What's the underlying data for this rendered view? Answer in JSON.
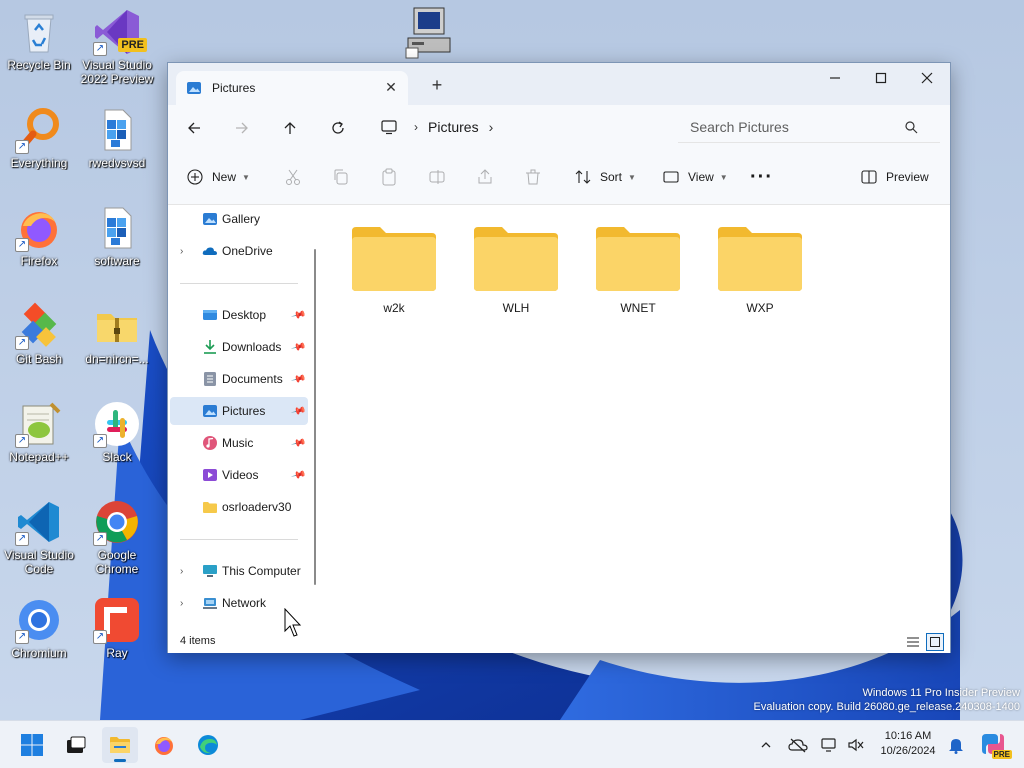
{
  "desktop": {
    "icons": [
      {
        "label": "Recycle Bin",
        "icon": "recycle-bin-icon"
      },
      {
        "label": "Visual Studio 2022 Preview",
        "icon": "visual-studio-icon",
        "badge": "PRE"
      },
      {
        "label": "Everything",
        "icon": "everything-search-icon"
      },
      {
        "label": "rwedvsvsd",
        "icon": "installer-file-icon"
      },
      {
        "label": "Firefox",
        "icon": "firefox-icon"
      },
      {
        "label": "software",
        "icon": "installer-file-icon"
      },
      {
        "label": "Git Bash",
        "icon": "git-bash-icon"
      },
      {
        "label": "dn=nircn=...",
        "icon": "zip-archive-icon"
      },
      {
        "label": "Notepad++",
        "icon": "notepad-plus-plus-icon"
      },
      {
        "label": "Slack",
        "icon": "slack-icon"
      },
      {
        "label": "Visual Studio Code",
        "icon": "vscode-icon"
      },
      {
        "label": "Google Chrome",
        "icon": "chrome-icon"
      },
      {
        "label": "Chromium",
        "icon": "chromium-icon"
      },
      {
        "label": "Ray",
        "icon": "ray-icon"
      }
    ]
  },
  "window": {
    "tab_title": "Pictures",
    "breadcrumb": "Pictures",
    "search_placeholder": "Search Pictures",
    "toolbar": {
      "new_label": "New",
      "sort_label": "Sort",
      "view_label": "View",
      "preview_label": "Preview"
    },
    "sidebar": {
      "items": [
        {
          "label": "Gallery",
          "icon": "gallery-icon",
          "pinned": false
        },
        {
          "label": "OneDrive",
          "icon": "onedrive-icon",
          "pinned": false
        },
        {
          "label": "Desktop",
          "icon": "desktop-folder-icon",
          "pinned": true
        },
        {
          "label": "Downloads",
          "icon": "downloads-icon",
          "pinned": true
        },
        {
          "label": "Documents",
          "icon": "documents-icon",
          "pinned": true
        },
        {
          "label": "Pictures",
          "icon": "pictures-icon",
          "pinned": true
        },
        {
          "label": "Music",
          "icon": "music-icon",
          "pinned": true
        },
        {
          "label": "Videos",
          "icon": "videos-icon",
          "pinned": true
        },
        {
          "label": "osrloaderv30",
          "icon": "folder-icon",
          "pinned": false
        },
        {
          "label": "This Computer",
          "icon": "this-computer-icon",
          "pinned": false
        },
        {
          "label": "Network",
          "icon": "network-icon",
          "pinned": false
        }
      ]
    },
    "folders": [
      {
        "name": "w2k"
      },
      {
        "name": "WLH"
      },
      {
        "name": "WNET"
      },
      {
        "name": "WXP"
      }
    ],
    "status": {
      "item_count": "4 items"
    }
  },
  "watermark": {
    "line1": "Windows 11 Pro Insider Preview",
    "line2": "Evaluation copy. Build 26080.ge_release.240308-1400"
  },
  "taskbar": {
    "time": "10:16 AM",
    "date": "10/26/2024",
    "copilot_badge": "PRE"
  },
  "colors": {
    "accent": "#0f6cbd",
    "folder": "#f6c94a",
    "selection": "#dbe7f6"
  }
}
